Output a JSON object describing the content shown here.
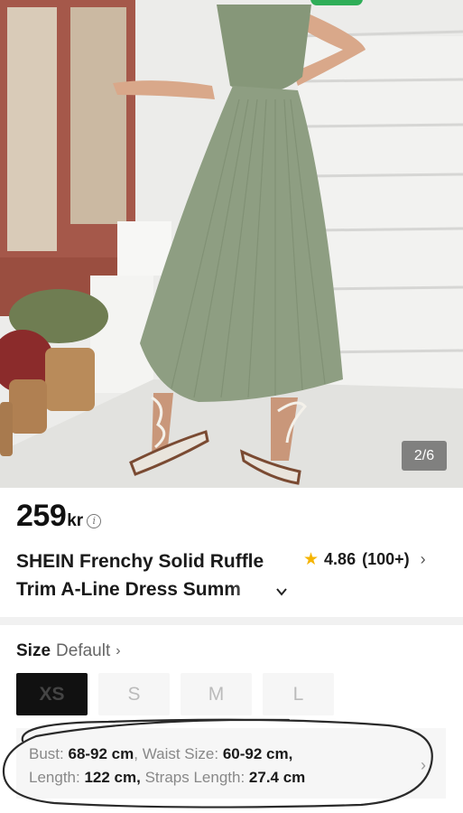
{
  "image": {
    "counter": "2/6",
    "alt": "model wearing green pleated dress with white sandals on stairs"
  },
  "product": {
    "price": "259",
    "currency": "kr",
    "info_glyph": "i",
    "title_line1": "SHEIN Frenchy Solid Ruffle",
    "title_line2": "Trim A-Line Dress Summ",
    "rating": "4.86",
    "review_count": "(100+)"
  },
  "size": {
    "label": "Size",
    "default_label": "Default",
    "options": [
      "XS",
      "S",
      "M",
      "L"
    ],
    "selected": "XS"
  },
  "measurements": {
    "bust_label": "Bust:",
    "bust_value": "68-92 cm",
    "waist_label": "Waist Size:",
    "waist_value": "60-92 cm,",
    "length_label": "Length:",
    "length_value": "122 cm,",
    "straps_label": "Straps Length:",
    "straps_value": "27.4 cm"
  },
  "colors": {
    "dress": "#8e9e82",
    "star": "#f5b400",
    "selected_size_bg": "#111111",
    "badge": "#2fae58"
  }
}
